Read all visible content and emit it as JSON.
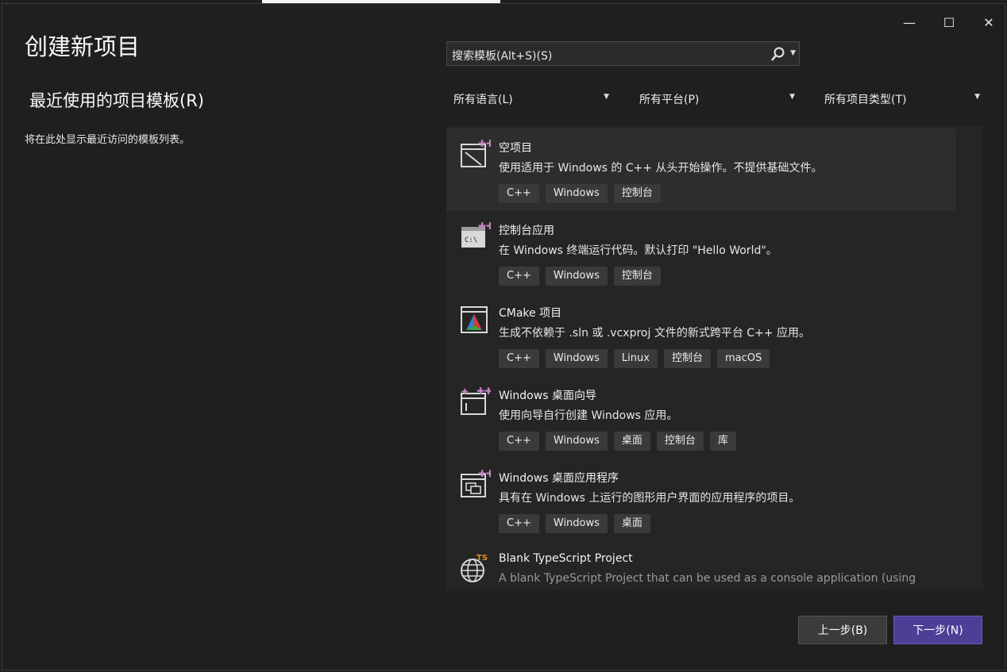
{
  "window": {
    "title": "创建新项目",
    "minimize_glyph": "—",
    "maximize_glyph": "☐",
    "close_glyph": "✕"
  },
  "recent": {
    "heading": "最近使用的项目模板(R)",
    "empty_text": "将在此处显示最近访问的模板列表。"
  },
  "search": {
    "placeholder": "搜索模板(Alt+S)(S)",
    "icon": "search-icon"
  },
  "filters": [
    {
      "label": "所有语言(L)"
    },
    {
      "label": "所有平台(P)"
    },
    {
      "label": "所有项目类型(T)"
    }
  ],
  "templates": [
    {
      "name": "空项目",
      "description": "使用适用于 Windows 的 C++ 从头开始操作。不提供基础文件。",
      "tags": [
        "C++",
        "Windows",
        "控制台"
      ],
      "icon": "empty-project-icon",
      "selected": true
    },
    {
      "name": "控制台应用",
      "description": "在 Windows 终端运行代码。默认打印 \"Hello World\"。",
      "tags": [
        "C++",
        "Windows",
        "控制台"
      ],
      "icon": "console-app-icon"
    },
    {
      "name": "CMake 项目",
      "description": "生成不依赖于 .sln 或 .vcxproj 文件的新式跨平台 C++ 应用。",
      "tags": [
        "C++",
        "Windows",
        "Linux",
        "控制台",
        "macOS"
      ],
      "icon": "cmake-icon"
    },
    {
      "name": "Windows 桌面向导",
      "description": "使用向导自行创建 Windows 应用。",
      "tags": [
        "C++",
        "Windows",
        "桌面",
        "控制台",
        "库"
      ],
      "icon": "desktop-wizard-icon"
    },
    {
      "name": "Windows 桌面应用程序",
      "description": "具有在 Windows 上运行的图形用户界面的应用程序的项目。",
      "tags": [
        "C++",
        "Windows",
        "桌面"
      ],
      "icon": "desktop-app-icon"
    },
    {
      "name": "Blank TypeScript Project",
      "description": "A blank TypeScript Project that can be used as a console application (using",
      "tags": [],
      "icon": "typescript-globe-icon"
    }
  ],
  "buttons": {
    "back": "上一步(B)",
    "next": "下一步(N)"
  },
  "colors": {
    "background": "#1f1f1f",
    "list_bg": "#252526",
    "selected_bg": "#2d2d2d",
    "tag_bg": "#3a3a3a",
    "accent": "#4c3f96",
    "sparkle": "#c586c0"
  }
}
